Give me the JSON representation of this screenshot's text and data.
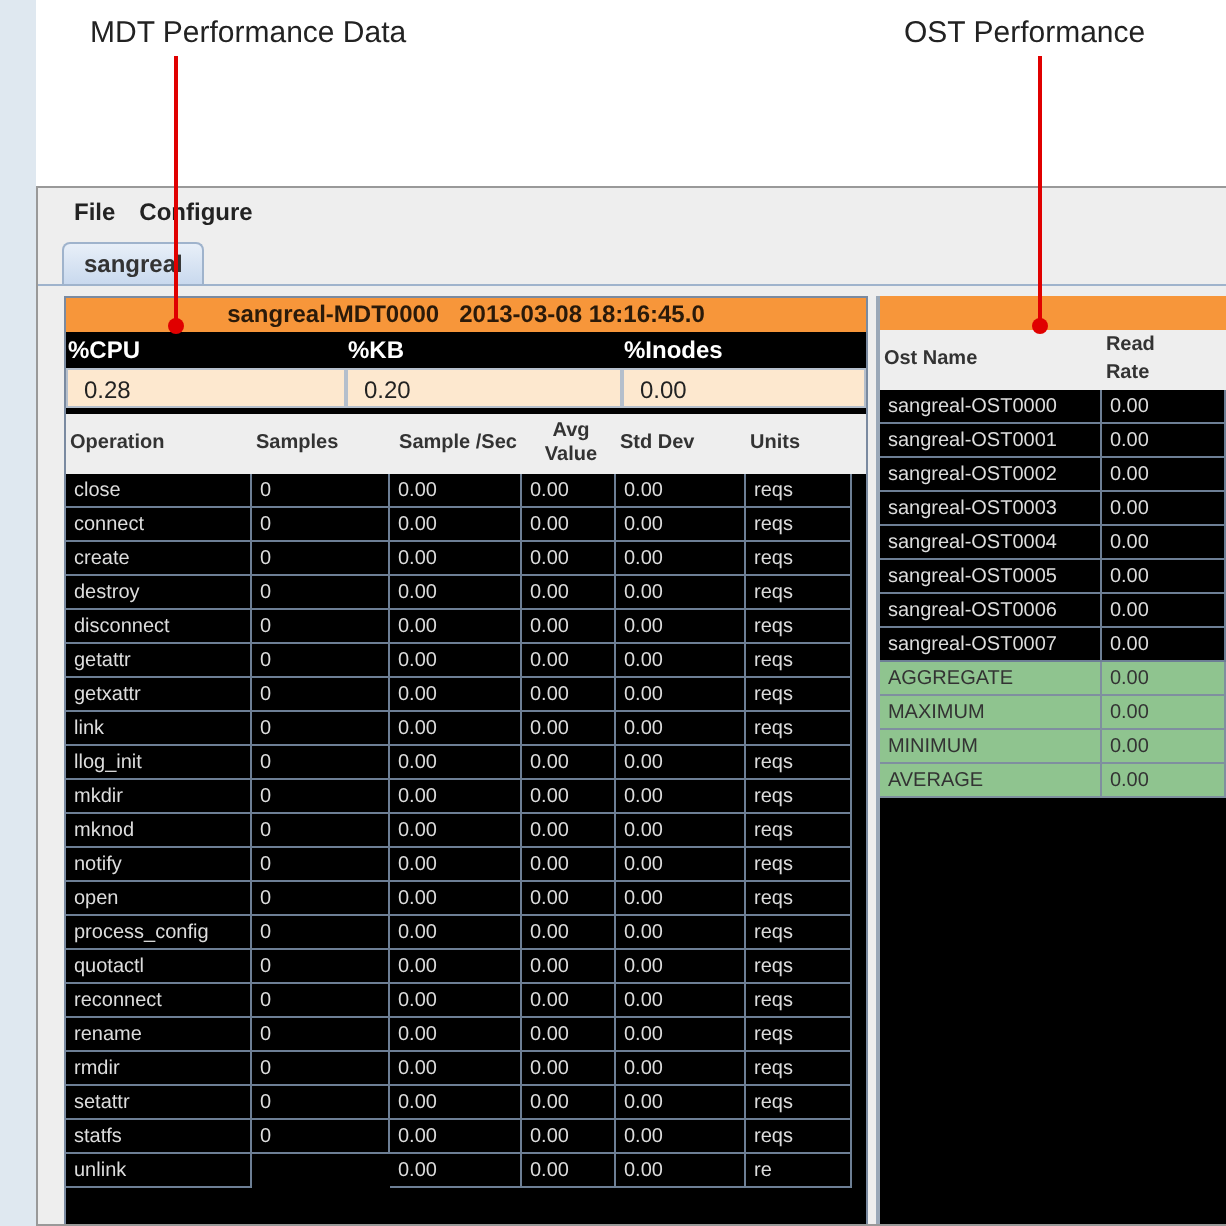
{
  "callouts": [
    {
      "label": "MDT Performance Data"
    },
    {
      "label": "OST Performance"
    }
  ],
  "menu": [
    "File",
    "Configure"
  ],
  "tabs": [
    {
      "label": "sangreal",
      "selected": true
    }
  ],
  "mdt": {
    "title": "sangreal-MDT0000",
    "timestamp": "2013-03-08 18:16:45.0",
    "metrics": [
      {
        "label": "%CPU",
        "value": "0.28"
      },
      {
        "label": "%KB",
        "value": "0.20"
      },
      {
        "label": "%Inodes",
        "value": "0.00"
      }
    ],
    "columns": [
      "Operation",
      "Samples",
      "Sample /Sec",
      "Avg Value",
      "Std Dev",
      "Units"
    ],
    "rows": [
      [
        "close",
        "0",
        "0.00",
        "0.00",
        "0.00",
        "reqs"
      ],
      [
        "connect",
        "0",
        "0.00",
        "0.00",
        "0.00",
        "reqs"
      ],
      [
        "create",
        "0",
        "0.00",
        "0.00",
        "0.00",
        "reqs"
      ],
      [
        "destroy",
        "0",
        "0.00",
        "0.00",
        "0.00",
        "reqs"
      ],
      [
        "disconnect",
        "0",
        "0.00",
        "0.00",
        "0.00",
        "reqs"
      ],
      [
        "getattr",
        "0",
        "0.00",
        "0.00",
        "0.00",
        "reqs"
      ],
      [
        "getxattr",
        "0",
        "0.00",
        "0.00",
        "0.00",
        "reqs"
      ],
      [
        "link",
        "0",
        "0.00",
        "0.00",
        "0.00",
        "reqs"
      ],
      [
        "llog_init",
        "0",
        "0.00",
        "0.00",
        "0.00",
        "reqs"
      ],
      [
        "mkdir",
        "0",
        "0.00",
        "0.00",
        "0.00",
        "reqs"
      ],
      [
        "mknod",
        "0",
        "0.00",
        "0.00",
        "0.00",
        "reqs"
      ],
      [
        "notify",
        "0",
        "0.00",
        "0.00",
        "0.00",
        "reqs"
      ],
      [
        "open",
        "0",
        "0.00",
        "0.00",
        "0.00",
        "reqs"
      ],
      [
        "process_config",
        "0",
        "0.00",
        "0.00",
        "0.00",
        "reqs"
      ],
      [
        "quotactl",
        "0",
        "0.00",
        "0.00",
        "0.00",
        "reqs"
      ],
      [
        "reconnect",
        "0",
        "0.00",
        "0.00",
        "0.00",
        "reqs"
      ],
      [
        "rename",
        "0",
        "0.00",
        "0.00",
        "0.00",
        "reqs"
      ],
      [
        "rmdir",
        "0",
        "0.00",
        "0.00",
        "0.00",
        "reqs"
      ],
      [
        "setattr",
        "0",
        "0.00",
        "0.00",
        "0.00",
        "reqs"
      ],
      [
        "statfs",
        "0",
        "0.00",
        "0.00",
        "0.00",
        "reqs"
      ],
      [
        "unlink",
        null,
        "0.00",
        "0.00",
        "0.00",
        "re"
      ]
    ]
  },
  "ost": {
    "columns": [
      "Ost Name",
      "Read Rate"
    ],
    "rows": [
      {
        "kind": "ost",
        "name": "sangreal-OST0000",
        "read_rate": "0.00"
      },
      {
        "kind": "ost",
        "name": "sangreal-OST0001",
        "read_rate": "0.00"
      },
      {
        "kind": "ost",
        "name": "sangreal-OST0002",
        "read_rate": "0.00"
      },
      {
        "kind": "ost",
        "name": "sangreal-OST0003",
        "read_rate": "0.00"
      },
      {
        "kind": "ost",
        "name": "sangreal-OST0004",
        "read_rate": "0.00"
      },
      {
        "kind": "ost",
        "name": "sangreal-OST0005",
        "read_rate": "0.00"
      },
      {
        "kind": "ost",
        "name": "sangreal-OST0006",
        "read_rate": "0.00"
      },
      {
        "kind": "ost",
        "name": "sangreal-OST0007",
        "read_rate": "0.00"
      },
      {
        "kind": "summary",
        "name": "AGGREGATE",
        "read_rate": "0.00"
      },
      {
        "kind": "summary",
        "name": "MAXIMUM",
        "read_rate": "0.00"
      },
      {
        "kind": "summary",
        "name": "MINIMUM",
        "read_rate": "0.00"
      },
      {
        "kind": "summary",
        "name": "AVERAGE",
        "read_rate": "0.00"
      }
    ]
  }
}
